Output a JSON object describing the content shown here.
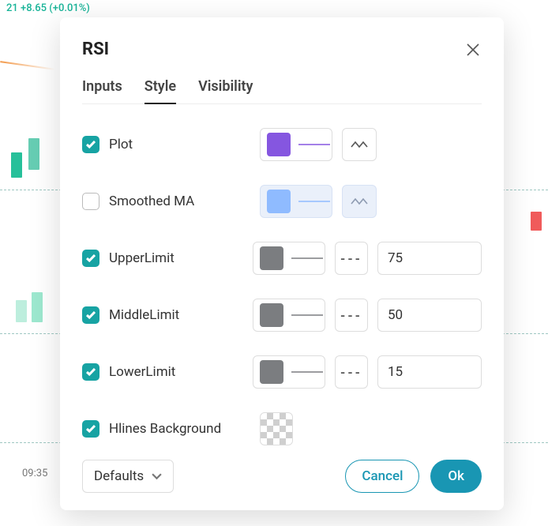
{
  "background": {
    "ticker": "21 +8.65 (+0.01%)",
    "time_label": "09:35"
  },
  "dialog": {
    "title": "RSI",
    "tabs": {
      "inputs": "Inputs",
      "style": "Style",
      "visibility": "Visibility"
    },
    "rows": {
      "plot": {
        "label": "Plot",
        "checked": true,
        "color": "#8556e0",
        "line_color": "#8556e0",
        "style_icon": "zigzag"
      },
      "smoothed": {
        "label": "Smoothed MA",
        "checked": false,
        "color": "#8fbbff",
        "line_color": "#8fbbff",
        "style_icon": "zigzag"
      },
      "upper": {
        "label": "UpperLimit",
        "checked": true,
        "color": "#7b7d80",
        "value": "75"
      },
      "middle": {
        "label": "MiddleLimit",
        "checked": true,
        "color": "#7b7d80",
        "value": "50"
      },
      "lower": {
        "label": "LowerLimit",
        "checked": true,
        "color": "#7b7d80",
        "value": "15"
      },
      "hlines": {
        "label": "Hlines Background",
        "checked": true
      }
    },
    "dash_indicator": "---",
    "footer": {
      "defaults": "Defaults",
      "cancel": "Cancel",
      "ok": "Ok"
    }
  }
}
